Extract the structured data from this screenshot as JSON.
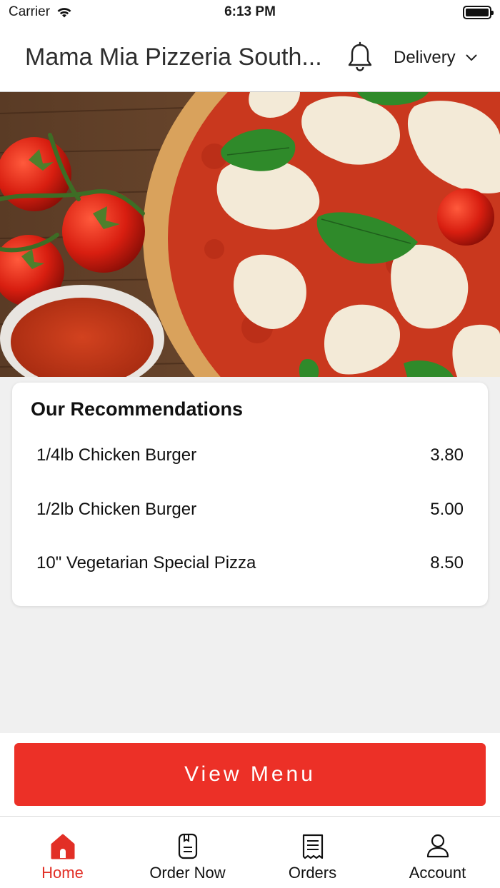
{
  "status_bar": {
    "carrier": "Carrier",
    "time": "6:13 PM"
  },
  "header": {
    "title": "Mama Mia Pizzeria South...",
    "delivery_label": "Delivery",
    "bell_icon": "bell-icon"
  },
  "hero": {
    "image": "pizza-with-tomatoes-and-basil"
  },
  "recommendations": {
    "title": "Our Recommendations",
    "items": [
      {
        "name": "1/4lb Chicken Burger",
        "price": "3.80"
      },
      {
        "name": "1/2lb Chicken Burger",
        "price": "5.00"
      },
      {
        "name": "10\" Vegetarian Special Pizza",
        "price": "8.50"
      }
    ]
  },
  "view_menu_label": "View Menu",
  "tabs": [
    {
      "label": "Home",
      "icon": "home-icon",
      "active": true
    },
    {
      "label": "Order Now",
      "icon": "order-book-icon",
      "active": false
    },
    {
      "label": "Orders",
      "icon": "receipt-icon",
      "active": false
    },
    {
      "label": "Account",
      "icon": "user-icon",
      "active": false
    }
  ],
  "colors": {
    "accent": "#ec3027",
    "active_tab": "#e22f26"
  }
}
